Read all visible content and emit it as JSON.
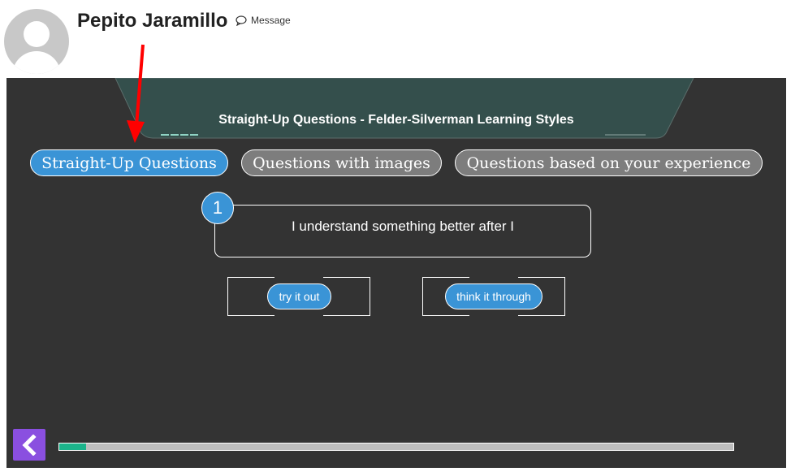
{
  "profile": {
    "name": "Pepito Jaramillo",
    "message_label": "Message",
    "avatar_icon": "default-avatar-icon",
    "message_icon": "speech-bubble-icon"
  },
  "quiz": {
    "title": "Straight-Up Questions - Felder-Silverman Learning Styles",
    "tabs": [
      {
        "label": "Straight-Up Questions",
        "active": true
      },
      {
        "label": "Questions with images",
        "active": false
      },
      {
        "label": "Questions based on your experience",
        "active": false
      }
    ],
    "question": {
      "number": "1",
      "text": "I understand something better after I"
    },
    "answers": [
      {
        "label": "try it out"
      },
      {
        "label": "think it through"
      }
    ],
    "progress": 0.04,
    "back_icon": "chevron-left-icon"
  },
  "colors": {
    "panel_bg": "#333333",
    "title_tab_bg": "#344f4c",
    "accent_blue": "#3a94d6",
    "inactive_tab": "#7d7d7d",
    "progress_fill": "#1bb48b",
    "back_button": "#8a4fe0",
    "annotation_arrow": "#ff0000"
  }
}
